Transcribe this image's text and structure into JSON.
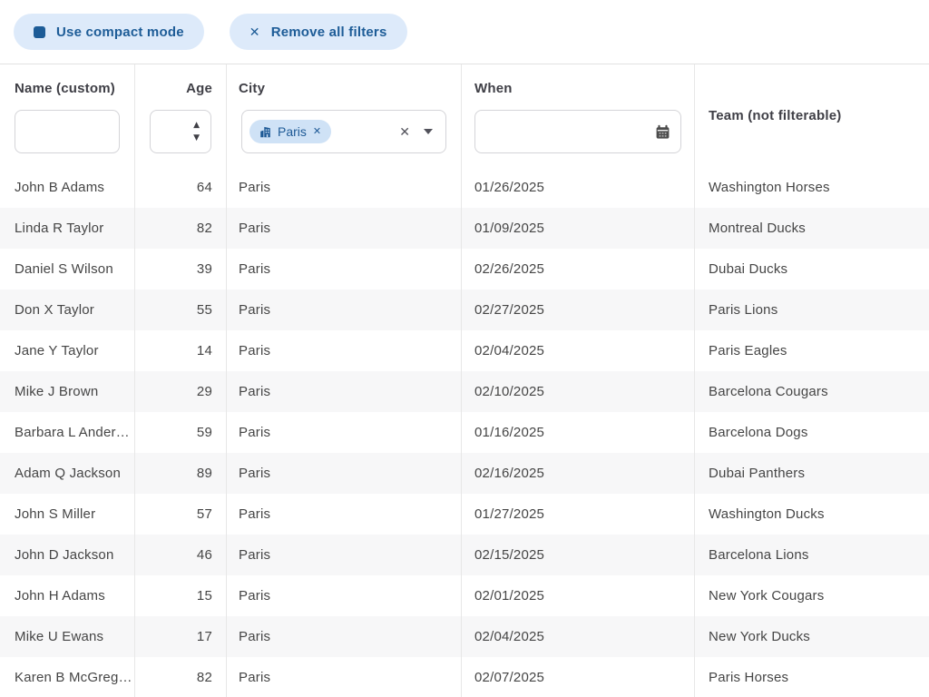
{
  "toolbar": {
    "compact_mode_label": "Use compact mode",
    "remove_filters_label": "Remove all filters"
  },
  "columns": {
    "name": "Name (custom)",
    "age": "Age",
    "city": "City",
    "when": "When",
    "team": "Team (not filterable)"
  },
  "filters": {
    "name_value": "",
    "age_value": "",
    "city_selected": [
      {
        "label": "Paris",
        "icon": "building-icon"
      }
    ],
    "when_value": ""
  },
  "icons": {
    "compact_toggle": "square-icon",
    "remove_filters": "x-icon",
    "chip_remove": "x-icon",
    "multiselect_clear": "x-icon",
    "multiselect_dropdown": "chevron-down-icon",
    "age_increment": "chevron-up-icon",
    "age_decrement": "chevron-down-icon",
    "date_picker": "calendar-icon"
  },
  "colors": {
    "accent_blue": "#1d5c97",
    "button_bg": "#ddeafa",
    "chip_bg": "#cfe2f6",
    "row_stripe": "#f7f7f8",
    "border": "#d4d4d8",
    "divider": "#e7e7e7",
    "text": "#454545"
  },
  "rows": [
    {
      "name": "John B Adams",
      "age": "64",
      "city": "Paris",
      "when": "01/26/2025",
      "team": "Washington Horses"
    },
    {
      "name": "Linda R Taylor",
      "age": "82",
      "city": "Paris",
      "when": "01/09/2025",
      "team": "Montreal Ducks"
    },
    {
      "name": "Daniel S Wilson",
      "age": "39",
      "city": "Paris",
      "when": "02/26/2025",
      "team": "Dubai Ducks"
    },
    {
      "name": "Don X Taylor",
      "age": "55",
      "city": "Paris",
      "when": "02/27/2025",
      "team": "Paris Lions"
    },
    {
      "name": "Jane Y Taylor",
      "age": "14",
      "city": "Paris",
      "when": "02/04/2025",
      "team": "Paris Eagles"
    },
    {
      "name": "Mike J Brown",
      "age": "29",
      "city": "Paris",
      "when": "02/10/2025",
      "team": "Barcelona Cougars"
    },
    {
      "name": "Barbara L Ander…",
      "age": "59",
      "city": "Paris",
      "when": "01/16/2025",
      "team": "Barcelona Dogs"
    },
    {
      "name": "Adam Q Jackson",
      "age": "89",
      "city": "Paris",
      "when": "02/16/2025",
      "team": "Dubai Panthers"
    },
    {
      "name": "John S Miller",
      "age": "57",
      "city": "Paris",
      "when": "01/27/2025",
      "team": "Washington Ducks"
    },
    {
      "name": "John D Jackson",
      "age": "46",
      "city": "Paris",
      "when": "02/15/2025",
      "team": "Barcelona Lions"
    },
    {
      "name": "John H Adams",
      "age": "15",
      "city": "Paris",
      "when": "02/01/2025",
      "team": "New York Cougars"
    },
    {
      "name": "Mike U Ewans",
      "age": "17",
      "city": "Paris",
      "when": "02/04/2025",
      "team": "New York Ducks"
    },
    {
      "name": "Karen B McGreg…",
      "age": "82",
      "city": "Paris",
      "when": "02/07/2025",
      "team": "Paris Horses"
    }
  ]
}
